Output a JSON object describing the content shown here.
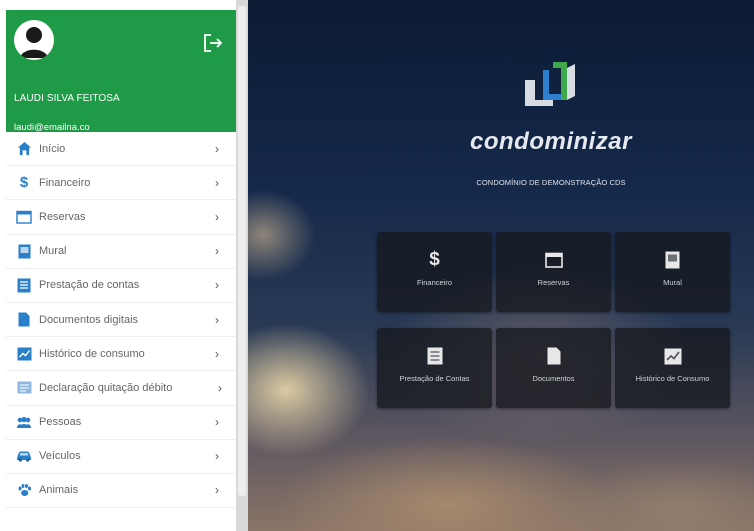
{
  "user": {
    "name": "LAUDI SILVA FEITOSA",
    "email": "laudi@emailna.co"
  },
  "menu": [
    {
      "label": "Início",
      "icon": "home-icon"
    },
    {
      "label": "Financeiro",
      "icon": "dollar-icon"
    },
    {
      "label": "Reservas",
      "icon": "calendar-icon"
    },
    {
      "label": "Mural",
      "icon": "board-icon"
    },
    {
      "label": "Prestação de contas",
      "icon": "ledger-icon"
    },
    {
      "label": "Documentos digitais",
      "icon": "document-icon"
    },
    {
      "label": "Histórico de consumo",
      "icon": "chart-icon"
    },
    {
      "label": "Declaração quitação débito",
      "icon": "certificate-icon"
    },
    {
      "label": "Pessoas",
      "icon": "people-icon"
    },
    {
      "label": "Veículos",
      "icon": "car-icon"
    },
    {
      "label": "Animais",
      "icon": "paw-icon"
    }
  ],
  "chevron": "›",
  "brand": {
    "name": "condominizar",
    "subtitle": "CONDOMÍNIO DE DEMONSTRAÇÃO CDS"
  },
  "tiles": [
    {
      "label": "Financeiro",
      "icon": "dollar-icon"
    },
    {
      "label": "Reservas",
      "icon": "calendar-icon"
    },
    {
      "label": "Mural",
      "icon": "board-icon"
    },
    {
      "label": "Prestação de Contas",
      "icon": "ledger-icon"
    },
    {
      "label": "Documentos",
      "icon": "document-icon"
    },
    {
      "label": "Histórico de Consumo",
      "icon": "chart-icon"
    }
  ],
  "colors": {
    "primary": "#1f9b47",
    "menu_icon": "#2a7fc9",
    "logo_green": "#3ea84a",
    "logo_blue": "#2f7fd0"
  }
}
